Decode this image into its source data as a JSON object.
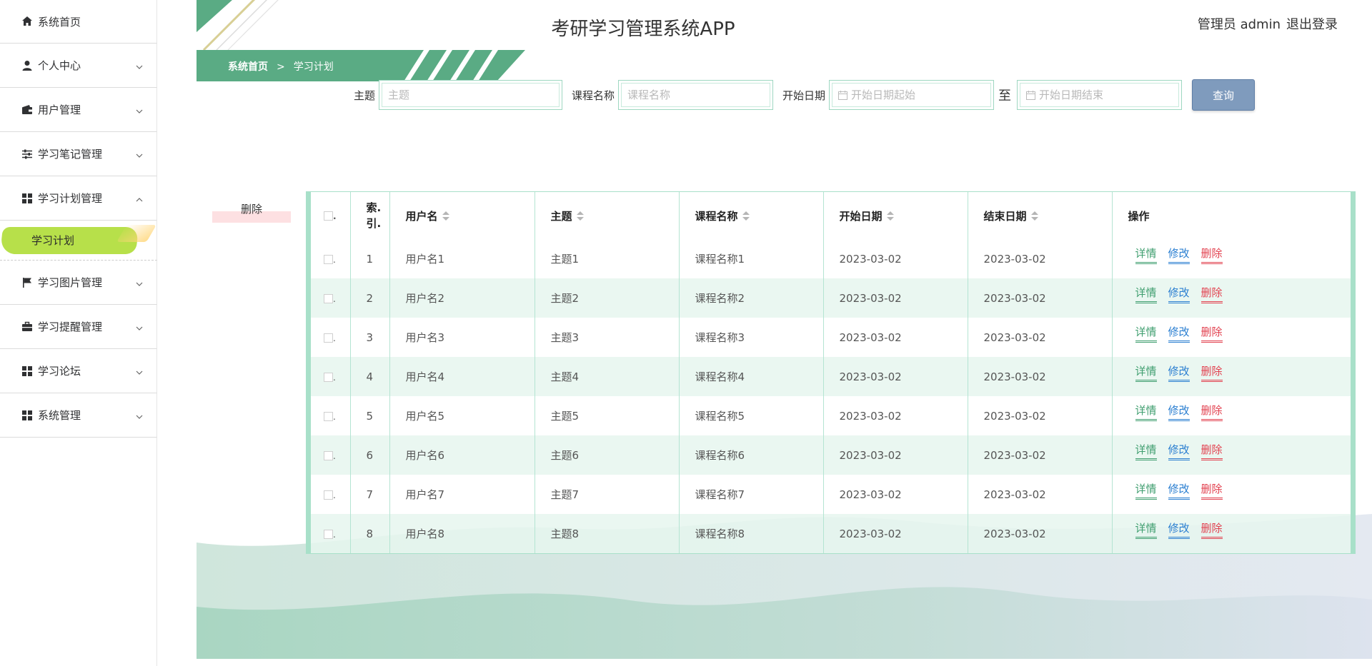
{
  "app": {
    "title": "考研学习管理系统APP"
  },
  "user": {
    "role_name": "管理员 admin",
    "logout_label": "退出登录"
  },
  "breadcrumb": {
    "home": "系统首页",
    "separator": ">",
    "current": "学习计划"
  },
  "sidebar": {
    "items": [
      {
        "label": "系统首页",
        "icon": "home-icon"
      },
      {
        "label": "个人中心",
        "icon": "user-icon"
      },
      {
        "label": "用户管理",
        "icon": "wallet-icon"
      },
      {
        "label": "学习笔记管理",
        "icon": "sliders-icon"
      },
      {
        "label": "学习计划管理",
        "icon": "grid-icon",
        "expanded": true
      },
      {
        "label": "学习图片管理",
        "icon": "flag-icon"
      },
      {
        "label": "学习提醒管理",
        "icon": "briefcase-icon"
      },
      {
        "label": "学习论坛",
        "icon": "grid-icon"
      },
      {
        "label": "系统管理",
        "icon": "grid-icon"
      }
    ],
    "active_sub": "学习计划"
  },
  "search": {
    "topic_label": "主题",
    "topic_placeholder": "主题",
    "course_label": "课程名称",
    "course_placeholder": "课程名称",
    "start_label": "开始日期",
    "start_from_placeholder": "开始日期起始",
    "to_label": "至",
    "start_to_placeholder": "开始日期结束",
    "query_label": "查询"
  },
  "actions": {
    "delete_label": "删除"
  },
  "table": {
    "headers": {
      "index": "索.引.",
      "username": "用户名",
      "topic": "主题",
      "course": "课程名称",
      "start": "开始日期",
      "end": "结束日期",
      "ops": "操作"
    },
    "op_labels": {
      "detail": "详情",
      "edit": "修改",
      "delete": "删除"
    },
    "rows": [
      {
        "idx": "1",
        "username": "用户名1",
        "topic": "主题1",
        "course": "课程名称1",
        "start": "2023-03-02",
        "end": "2023-03-02"
      },
      {
        "idx": "2",
        "username": "用户名2",
        "topic": "主题2",
        "course": "课程名称2",
        "start": "2023-03-02",
        "end": "2023-03-02"
      },
      {
        "idx": "3",
        "username": "用户名3",
        "topic": "主题3",
        "course": "课程名称3",
        "start": "2023-03-02",
        "end": "2023-03-02"
      },
      {
        "idx": "4",
        "username": "用户名4",
        "topic": "主题4",
        "course": "课程名称4",
        "start": "2023-03-02",
        "end": "2023-03-02"
      },
      {
        "idx": "5",
        "username": "用户名5",
        "topic": "主题5",
        "course": "课程名称5",
        "start": "2023-03-02",
        "end": "2023-03-02"
      },
      {
        "idx": "6",
        "username": "用户名6",
        "topic": "主题6",
        "course": "课程名称6",
        "start": "2023-03-02",
        "end": "2023-03-02"
      },
      {
        "idx": "7",
        "username": "用户名7",
        "topic": "主题7",
        "course": "课程名称7",
        "start": "2023-03-02",
        "end": "2023-03-02"
      },
      {
        "idx": "8",
        "username": "用户名8",
        "topic": "主题8",
        "course": "课程名称8",
        "start": "2023-03-02",
        "end": "2023-03-02"
      }
    ]
  },
  "colors": {
    "primary": "#5aab84",
    "accent_lime": "#b7e04a",
    "query_btn": "#7f9bbd",
    "detail": "#3f9e6f",
    "edit": "#2b7fd1",
    "delete": "#e2414f"
  }
}
